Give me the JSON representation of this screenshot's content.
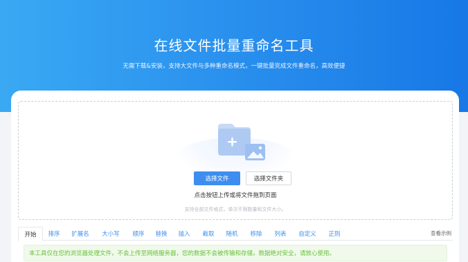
{
  "hero": {
    "title": "在线文件批量重命名工具",
    "subtitle": "无需下载&安装，支持大文件与多种重命名模式，一键批量完成文件重命名，高效便捷"
  },
  "upload": {
    "select_files_label": "选择文件",
    "select_folder_label": "选择文件夹",
    "hint": "点击按钮上传或将文件拖到页面",
    "note": "支持全部文件格式，单次不限数量和文件大小。"
  },
  "tabs": [
    {
      "label": "开始"
    },
    {
      "label": "排序"
    },
    {
      "label": "扩展名"
    },
    {
      "label": "大小写"
    },
    {
      "label": "顺序"
    },
    {
      "label": "替换"
    },
    {
      "label": "插入"
    },
    {
      "label": "截取"
    },
    {
      "label": "随机"
    },
    {
      "label": "移除"
    },
    {
      "label": "列表"
    },
    {
      "label": "自定义"
    },
    {
      "label": "正则"
    }
  ],
  "example_link": "查看示例",
  "notice": "本工具仅在您的浏览器处理文件，不会上传至网络服务器，您的数据不会被传输和存储，数据绝对安全，请放心使用。",
  "colors": {
    "primary": "#3d8ef0",
    "hero_start": "#3aa9f3",
    "hero_end": "#1778e6",
    "notice_bg": "#f0f9eb",
    "notice_text": "#67c23a"
  },
  "icons": {
    "upload_illustration": "folder-image-plus-icon"
  }
}
